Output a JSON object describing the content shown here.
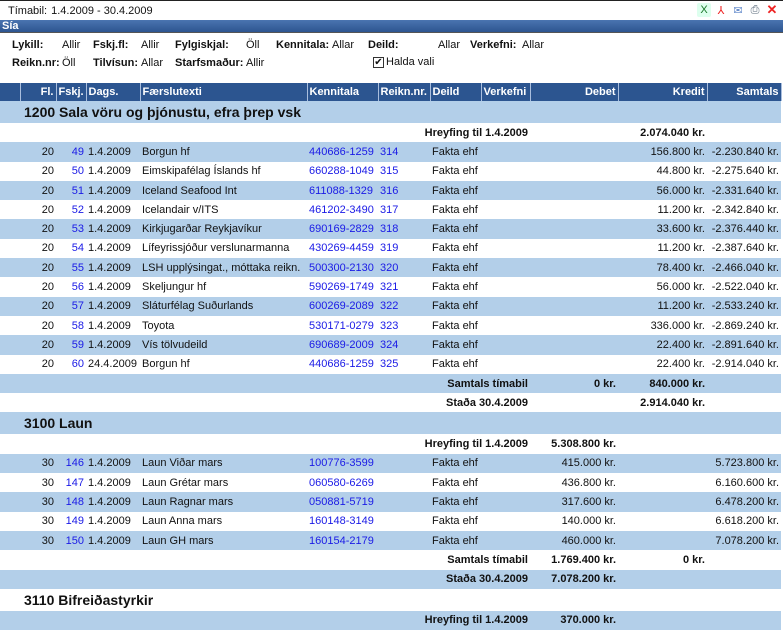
{
  "title": {
    "label": "Tímabil:",
    "value": "1.4.2009 - 30.4.2009"
  },
  "toolbar": [
    {
      "icon": "excel-icon"
    },
    {
      "icon": "pdf-icon"
    },
    {
      "icon": "email-icon"
    },
    {
      "icon": "print-icon"
    },
    {
      "icon": "close-icon"
    }
  ],
  "filter_bar": {
    "title": "Sía"
  },
  "filters": {
    "lykill": {
      "label": "Lykill:",
      "value": "Allir"
    },
    "fskjfl": {
      "label": "Fskj.fl:",
      "value": "Allir"
    },
    "fylgiskjal": {
      "label": "Fylgiskjal:",
      "value": "Öll"
    },
    "kennitala": {
      "label": "Kennitala:",
      "value": "Allar"
    },
    "deild": {
      "label": "Deild:",
      "value": "Allar"
    },
    "verkefni": {
      "label": "Verkefni:",
      "value": "Allar"
    },
    "reiknnr": {
      "label": "Reikn.nr:",
      "value": "Öll"
    },
    "tilvisun": {
      "label": "Tilvísun:",
      "value": "Allar"
    },
    "starfsmadur": {
      "label": "Starfsmaður:",
      "value": "Allir"
    },
    "halda_vali": {
      "label": "Halda vali",
      "checked": true
    }
  },
  "columns": [
    "",
    "Fl.",
    "Fskj.",
    "Dags.",
    "Færslutexti",
    "Kennitala",
    "Reikn.nr.",
    "Deild",
    "Verkefni",
    "Debet",
    "Kredit",
    "Samtals"
  ],
  "sections": [
    {
      "account": "1200  Sala vöru og þjónustu, efra þrep vsk",
      "opening": {
        "label": "Hreyfing til 1.4.2009",
        "debet": "",
        "kredit": "2.074.040 kr."
      },
      "rows": [
        [
          "20",
          "49",
          "1.4.2009",
          "Borgun hf",
          "440686-1259",
          "314",
          "Fakta ehf",
          "",
          "",
          "156.800 kr.",
          "-2.230.840 kr."
        ],
        [
          "20",
          "50",
          "1.4.2009",
          "Eimskipafélag Íslands hf",
          "660288-1049",
          "315",
          "Fakta ehf",
          "",
          "",
          "44.800 kr.",
          "-2.275.640 kr."
        ],
        [
          "20",
          "51",
          "1.4.2009",
          "Iceland Seafood Int",
          "611088-1329",
          "316",
          "Fakta ehf",
          "",
          "",
          "56.000 kr.",
          "-2.331.640 kr."
        ],
        [
          "20",
          "52",
          "1.4.2009",
          "Icelandair v/ITS",
          "461202-3490",
          "317",
          "Fakta ehf",
          "",
          "",
          "11.200 kr.",
          "-2.342.840 kr."
        ],
        [
          "20",
          "53",
          "1.4.2009",
          "Kirkjugarðar Reykjavíkur",
          "690169-2829",
          "318",
          "Fakta ehf",
          "",
          "",
          "33.600 kr.",
          "-2.376.440 kr."
        ],
        [
          "20",
          "54",
          "1.4.2009",
          "Lífeyrissjóður verslunarmanna",
          "430269-4459",
          "319",
          "Fakta ehf",
          "",
          "",
          "11.200 kr.",
          "-2.387.640 kr."
        ],
        [
          "20",
          "55",
          "1.4.2009",
          "LSH upplýsingat., móttaka reikn.",
          "500300-2130",
          "320",
          "Fakta ehf",
          "",
          "",
          "78.400 kr.",
          "-2.466.040 kr."
        ],
        [
          "20",
          "56",
          "1.4.2009",
          "Skeljungur hf",
          "590269-1749",
          "321",
          "Fakta ehf",
          "",
          "",
          "56.000 kr.",
          "-2.522.040 kr."
        ],
        [
          "20",
          "57",
          "1.4.2009",
          "Sláturfélag Suðurlands",
          "600269-2089",
          "322",
          "Fakta ehf",
          "",
          "",
          "11.200 kr.",
          "-2.533.240 kr."
        ],
        [
          "20",
          "58",
          "1.4.2009",
          "Toyota",
          "530171-0279",
          "323",
          "Fakta ehf",
          "",
          "",
          "336.000 kr.",
          "-2.869.240 kr."
        ],
        [
          "20",
          "59",
          "1.4.2009",
          "Vís tölvudeild",
          "690689-2009",
          "324",
          "Fakta ehf",
          "",
          "",
          "22.400 kr.",
          "-2.891.640 kr."
        ],
        [
          "20",
          "60",
          "24.4.2009",
          "Borgun hf",
          "440686-1259",
          "325",
          "Fakta ehf",
          "",
          "",
          "22.400 kr.",
          "-2.914.040 kr."
        ]
      ],
      "period_total": {
        "label": "Samtals tímabil",
        "debet": "0 kr.",
        "kredit": "840.000 kr."
      },
      "closing": {
        "label": "Staða 30.4.2009",
        "debet": "",
        "kredit": "2.914.040 kr."
      }
    },
    {
      "account": "3100  Laun",
      "opening": {
        "label": "Hreyfing til 1.4.2009",
        "debet": "5.308.800 kr.",
        "kredit": ""
      },
      "rows": [
        [
          "30",
          "146",
          "1.4.2009",
          "Laun Viðar mars",
          "100776-3599",
          "",
          "Fakta ehf",
          "",
          "415.000 kr.",
          "",
          "5.723.800 kr."
        ],
        [
          "30",
          "147",
          "1.4.2009",
          "Laun Grétar mars",
          "060580-6269",
          "",
          "Fakta ehf",
          "",
          "436.800 kr.",
          "",
          "6.160.600 kr."
        ],
        [
          "30",
          "148",
          "1.4.2009",
          "Laun Ragnar mars",
          "050881-5719",
          "",
          "Fakta ehf",
          "",
          "317.600 kr.",
          "",
          "6.478.200 kr."
        ],
        [
          "30",
          "149",
          "1.4.2009",
          "Laun Anna mars",
          "160148-3149",
          "",
          "Fakta ehf",
          "",
          "140.000 kr.",
          "",
          "6.618.200 kr."
        ],
        [
          "30",
          "150",
          "1.4.2009",
          "Laun GH mars",
          "160154-2179",
          "",
          "Fakta ehf",
          "",
          "460.000 kr.",
          "",
          "7.078.200 kr."
        ]
      ],
      "period_total": {
        "label": "Samtals tímabil",
        "debet": "1.769.400 kr.",
        "kredit": "0 kr."
      },
      "closing": {
        "label": "Staða 30.4.2009",
        "debet": "7.078.200 kr.",
        "kredit": ""
      }
    },
    {
      "account": "3110  Bifreiðastyrkir",
      "opening": {
        "label": "Hreyfing til 1.4.2009",
        "debet": "370.000 kr.",
        "kredit": ""
      },
      "rows": []
    }
  ],
  "colors": {
    "header": "#2c5590",
    "row_alt": "#b3cfe9",
    "link": "#1a1ae6"
  }
}
